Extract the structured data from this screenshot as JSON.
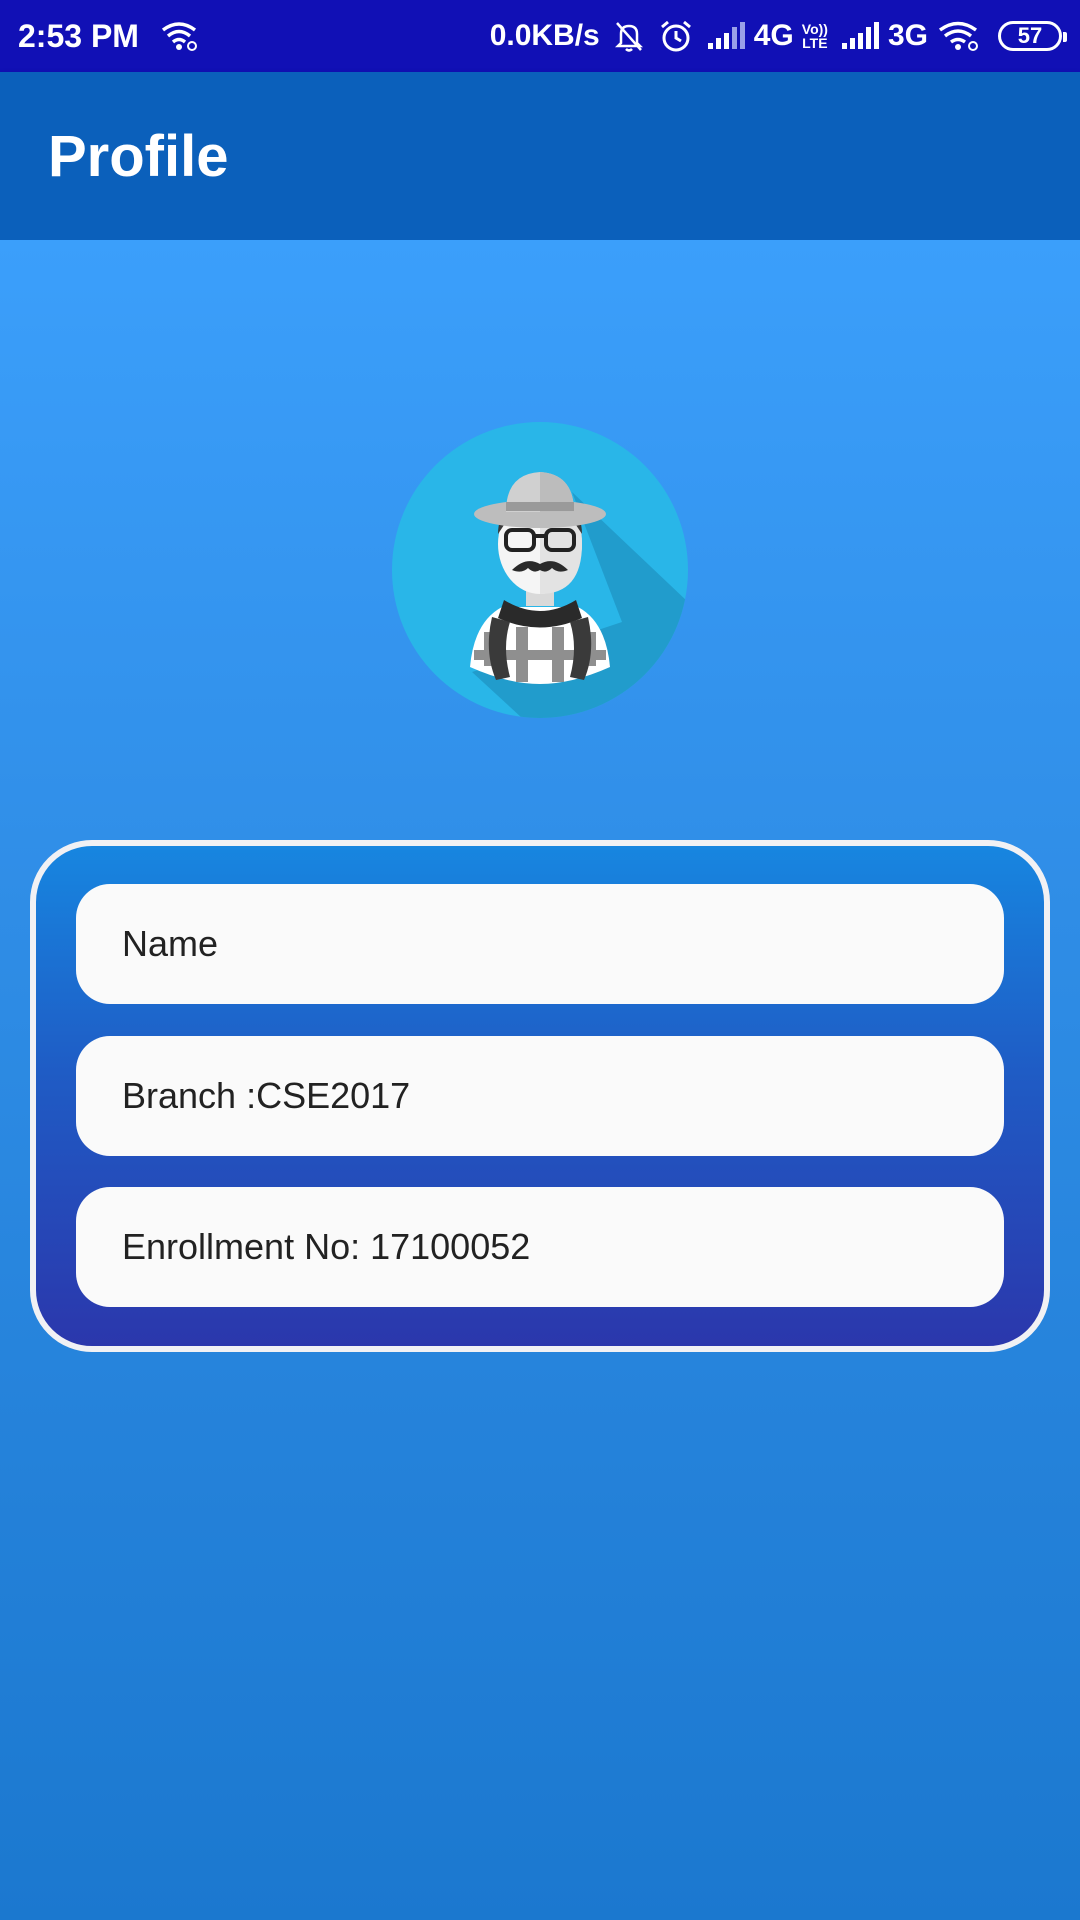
{
  "status_bar": {
    "time": "2:53 PM",
    "network_speed": "0.0KB/s",
    "network_1": "4G",
    "volte": [
      "Vo))",
      "LTE"
    ],
    "network_2": "3G",
    "battery": "57",
    "icons": [
      "wifi-icon",
      "mute-bell-icon",
      "alarm-icon",
      "signal-icon",
      "signal-icon",
      "wifi-icon"
    ]
  },
  "app_bar": {
    "title": "Profile"
  },
  "profile": {
    "avatar_icon": "avatar-hipster-icon",
    "name_label": "Name",
    "branch_label": "Branch :CSE2017",
    "enrollment_label": "Enrollment No: 17100052"
  },
  "colors": {
    "status_bar": "#1110b5",
    "app_bar": "#0b60bb",
    "background_top": "#3b9ffb",
    "background_bottom": "#1b78cf",
    "card_top": "#1786e0",
    "card_bottom": "#2b37ac",
    "field": "#fafafa",
    "avatar_circle": "#29b6e8"
  }
}
